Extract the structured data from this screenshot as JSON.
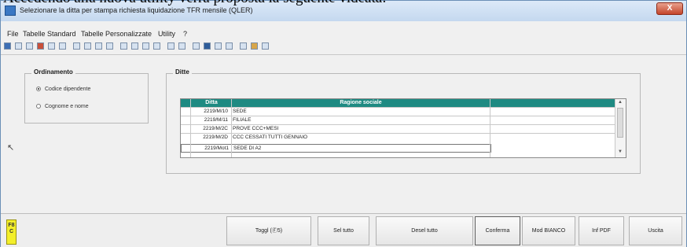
{
  "document": {
    "caption": "Accedendo alla nuova utility verrà proposta la seguente videata:"
  },
  "window": {
    "title": "Selezionare la ditta per stampa richiesta liquidazione TFR mensile (QLER)",
    "close_label": "X"
  },
  "menu": {
    "items": [
      "File",
      "Tabelle Standard",
      "Tabelle Personalizzate",
      "Utility",
      "?"
    ]
  },
  "toolbar": {
    "icons": [
      "save-icon",
      "print-icon",
      "back-icon",
      "color-icon",
      "copy-icon",
      "paste-icon",
      "cut-icon",
      "undo-icon",
      "find-icon",
      "refresh-icon",
      "first-icon",
      "prev-icon",
      "next-icon",
      "last-icon",
      "filter-icon",
      "calc-icon",
      "doc-icon",
      "box-icon",
      "chart-icon",
      "table-icon",
      "settings-icon",
      "lock-icon",
      "help-icon"
    ]
  },
  "ordinamento": {
    "label": "Ordinamento",
    "options": [
      {
        "label": "Codice dipendente",
        "selected": true
      },
      {
        "label": "Cognome e nome",
        "selected": false
      }
    ]
  },
  "ditte": {
    "label": "Ditte",
    "columns": [
      "Ditta",
      "Ragione sociale"
    ],
    "rows": [
      {
        "code": "2219/M/10",
        "name": "SEDE"
      },
      {
        "code": "2219/M/11",
        "name": "FILIALE"
      },
      {
        "code": "2219/M/2C",
        "name": "PROVE CCC+MESI"
      },
      {
        "code": "2219/M/2D",
        "name": "CCC CESSATI TUTTI GENNAIO"
      },
      {
        "code": "2219/Mot1",
        "name": "SEDE DI A2"
      }
    ]
  },
  "side_badge": "F8 C",
  "buttons": {
    "toggle": "Toggl (Ⓕ5)",
    "select_all": "Sel tutto",
    "deselect_all": "Desel tutto",
    "confirm": "Conferma",
    "mod_bianco": "Mod BIANCO",
    "inf_pdf": "Inf PDF",
    "exit": "Uscita"
  },
  "colors": {
    "grid_header": "#1e8a82",
    "title_bar": "#c4d8ef",
    "close_button": "#c4452a",
    "badge": "#f3ef2b"
  }
}
